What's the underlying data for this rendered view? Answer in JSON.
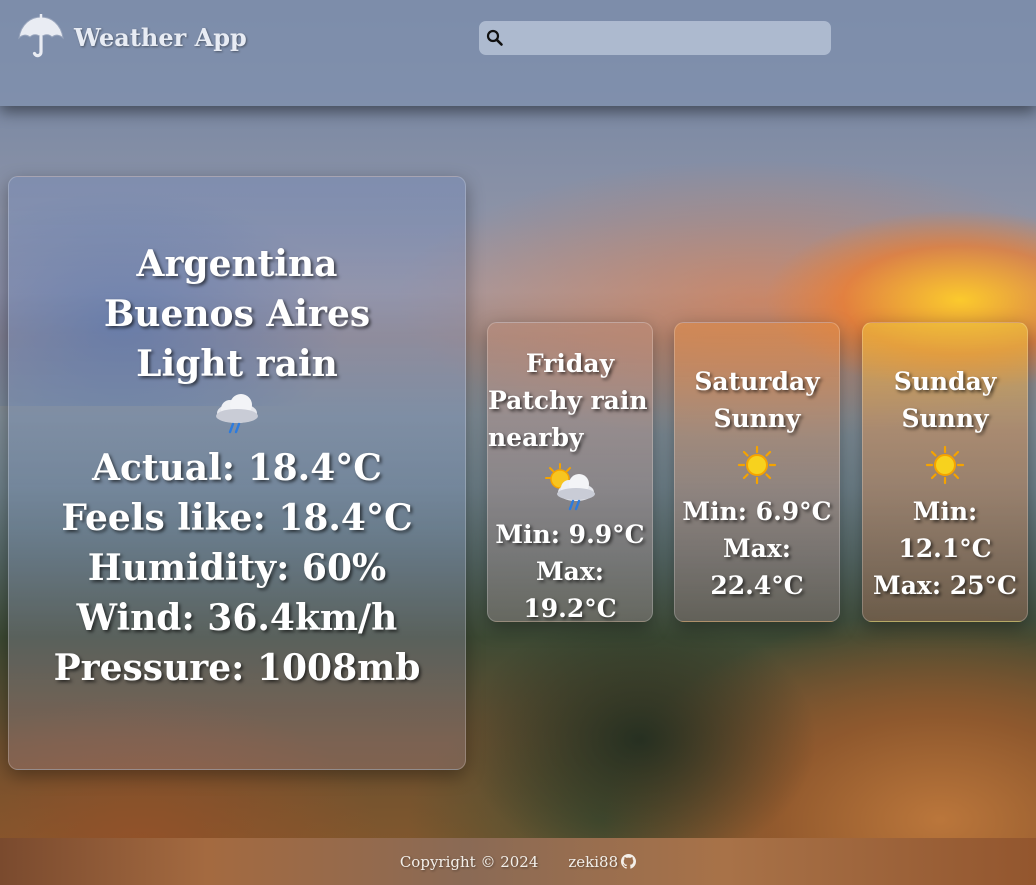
{
  "header": {
    "app_title": "Weather App",
    "search": {
      "value": "",
      "placeholder": ""
    }
  },
  "current": {
    "country": "Argentina",
    "city": "Buenos Aires",
    "condition": "Light rain",
    "icon": "cloud-rain-icon",
    "actual": "Actual: 18.4°C",
    "feels_like": "Feels like: 18.4°C",
    "humidity": "Humidity: 60%",
    "wind": "Wind: 36.4km/h",
    "pressure": "Pressure: 1008mb"
  },
  "forecast": [
    {
      "day": "Friday",
      "condition": "Patchy rain nearby",
      "icon": "sun-behind-rain-cloud-icon",
      "min": "Min: 9.9°C",
      "max": "Max: 19.2°C"
    },
    {
      "day": "Saturday",
      "condition": "Sunny",
      "icon": "sun-icon",
      "min": "Min: 6.9°C",
      "max": "Max: 22.4°C"
    },
    {
      "day": "Sunday",
      "condition": "Sunny",
      "icon": "sun-icon",
      "min": "Min: 12.1°C",
      "max": "Max: 25°C"
    }
  ],
  "footer": {
    "copyright": "Copyright © 2024",
    "author": "zeki88",
    "author_icon": "github-icon"
  },
  "colors": {
    "header_bg": "#8291af",
    "text": "#ffffff",
    "sun_yellow": "#f7c520",
    "sun_ray": "#f5a300"
  }
}
